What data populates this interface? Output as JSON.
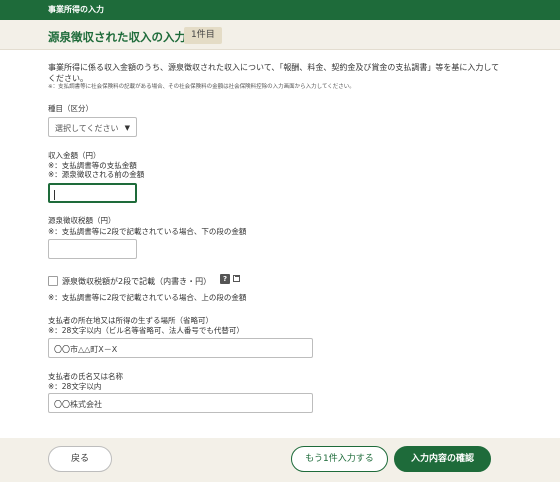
{
  "header": {
    "title": "事業所得の入力"
  },
  "section": {
    "title": "源泉徴収された収入の入力",
    "count_badge": "1件目"
  },
  "intro": {
    "text": "事業所得に係る収入金額のうち、源泉徴収された収入について、「報酬、料金、契約金及び賞金の支払調書」等を基に入力してください。",
    "note": "※：支払調書等に社会保険料の記載がある場合、その社会保険料の金額は社会保険料控除の入力画面から入力してください。"
  },
  "category": {
    "label": "種目（区分）",
    "select_placeholder": "選択してください"
  },
  "income": {
    "label": "収入金額（円）",
    "note1": "※：支払調書等の支払金額",
    "note2": "※：源泉徴収される前の金額",
    "value": ""
  },
  "withholding": {
    "label": "源泉徴収税額（円）",
    "note": "※：支払調書等に2段で記載されている場合、下の段の金額",
    "value": ""
  },
  "two_row": {
    "checkbox_label": "源泉徴収税額が2段で記載（内書き・円）",
    "help_icon": "?",
    "note": "※：支払調書等に2段で記載されている場合、上の段の金額",
    "checked": false
  },
  "payer_address": {
    "label": "支払者の所在地又は所得の生ずる場所（省略可）",
    "note": "※：28文字以内（ビル名等省略可、法人番号でも代替可）",
    "value": "〇〇市△△町X－X"
  },
  "payer_name": {
    "label": "支払者の氏名又は名称",
    "note": "※：28文字以内",
    "value": "〇〇株式会社"
  },
  "footer": {
    "back_label": "戻る",
    "add_more_label": "もう1件入力する",
    "confirm_label": "入力内容の確認"
  },
  "colors": {
    "primary": "#1e6b3a",
    "titlebar_bg": "#f3f0e8",
    "badge_bg": "#e4dcc6"
  },
  "icons": {
    "select_arrow": "dropdown-arrow-icon",
    "help": "help-icon",
    "window": "new-window-icon"
  }
}
